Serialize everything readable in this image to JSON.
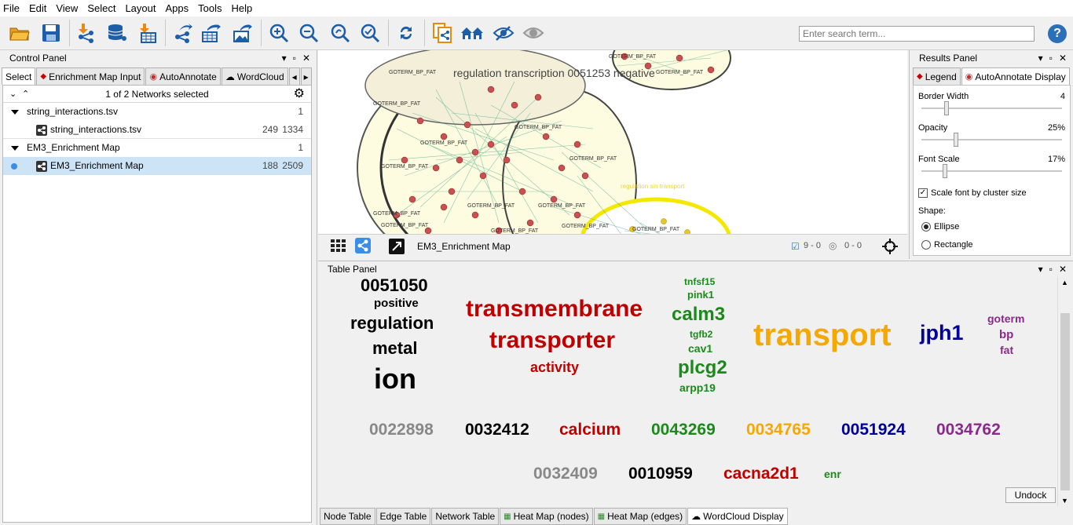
{
  "menu": [
    "File",
    "Edit",
    "View",
    "Select",
    "Layout",
    "Apps",
    "Tools",
    "Help"
  ],
  "search": {
    "placeholder": "Enter search term..."
  },
  "help_label": "?",
  "control_panel": {
    "title": "Control Panel",
    "tabs": [
      "Select",
      "Enrichment Map Input",
      "AutoAnnotate",
      "WordCloud"
    ],
    "networks_selected": "1 of 2 Networks selected",
    "networks": [
      {
        "name": "string_interactions.tsv",
        "count": "1"
      },
      {
        "name": "string_interactions.tsv",
        "nodes": "249",
        "edges": "1334"
      },
      {
        "name": "EM3_Enrichment Map",
        "count": "1"
      },
      {
        "name": "EM3_Enrichment Map",
        "nodes": "188",
        "edges": "2509"
      }
    ]
  },
  "network_view": {
    "cluster_label": "regulation transcription 0051253 negative",
    "small_label": "regulation sin transport",
    "node_label": "GOTERM_BP_FAT",
    "toolbar_name": "EM3_Enrichment Map",
    "selected_nodes": "9 - 0",
    "hidden_nodes": "0 - 0"
  },
  "results_panel": {
    "title": "Results Panel",
    "tabs": [
      "Legend",
      "AutoAnnotate Display"
    ],
    "border_width": {
      "label": "Border Width",
      "value": "4",
      "fraction": 0.18
    },
    "opacity": {
      "label": "Opacity",
      "value": "25%",
      "fraction": 0.25
    },
    "font_scale": {
      "label": "Font Scale",
      "value": "17%",
      "fraction": 0.17
    },
    "scale_font": "Scale font by cluster size",
    "shape_label": "Shape:",
    "shape_options": [
      "Ellipse",
      "Rectangle"
    ],
    "shape_selected": "Ellipse"
  },
  "table_panel": {
    "title": "Table Panel",
    "undock": "Undock",
    "tabs": [
      "Node Table",
      "Edge Table",
      "Network Table",
      "Heat Map (nodes)",
      "Heat Map (edges)",
      "WordCloud Display"
    ],
    "words": [
      {
        "text": "0051050",
        "color": "#000000"
      },
      {
        "text": "positive",
        "color": "#000000"
      },
      {
        "text": "regulation",
        "color": "#000000"
      },
      {
        "text": "metal",
        "color": "#000000"
      },
      {
        "text": "ion",
        "color": "#000000"
      },
      {
        "text": "transmembrane",
        "color": "#c00000"
      },
      {
        "text": "transporter",
        "color": "#c00000"
      },
      {
        "text": "activity",
        "color": "#c00000"
      },
      {
        "text": "tnfsf15",
        "color": "#1a8a1a"
      },
      {
        "text": "pink1",
        "color": "#1a8a1a"
      },
      {
        "text": "calm3",
        "color": "#1a8a1a"
      },
      {
        "text": "tgfb2",
        "color": "#1a8a1a"
      },
      {
        "text": "cav1",
        "color": "#1a8a1a"
      },
      {
        "text": "plcg2",
        "color": "#1a8a1a"
      },
      {
        "text": "arpp19",
        "color": "#1a8a1a"
      },
      {
        "text": "transport",
        "color": "#f5a800"
      },
      {
        "text": "jph1",
        "color": "#000099"
      },
      {
        "text": "goterm",
        "color": "#8a2a8a"
      },
      {
        "text": "bp",
        "color": "#8a2a8a"
      },
      {
        "text": "fat",
        "color": "#8a2a8a"
      },
      {
        "text": "0022898",
        "color": "#888888"
      },
      {
        "text": "0032412",
        "color": "#000000"
      },
      {
        "text": "calcium",
        "color": "#c00000"
      },
      {
        "text": "0043269",
        "color": "#1a8a1a"
      },
      {
        "text": "0034765",
        "color": "#f5a800"
      },
      {
        "text": "0051924",
        "color": "#000099"
      },
      {
        "text": "0034762",
        "color": "#8a2a8a"
      },
      {
        "text": "0032409",
        "color": "#888888"
      },
      {
        "text": "0010959",
        "color": "#000000"
      },
      {
        "text": "cacna2d1",
        "color": "#c00000"
      },
      {
        "text": "enr",
        "color": "#1a8a1a"
      }
    ]
  }
}
